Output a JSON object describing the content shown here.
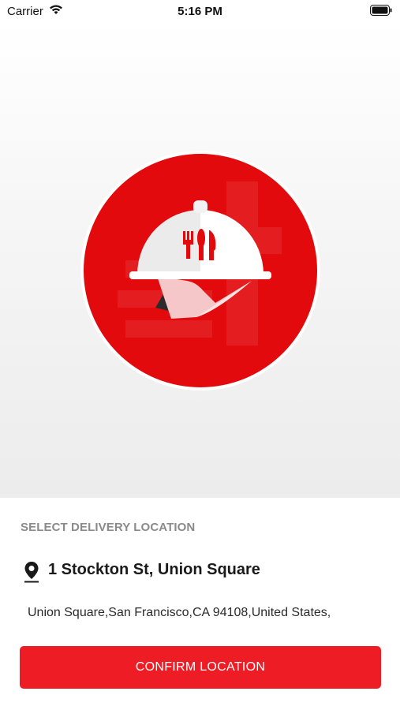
{
  "status_bar": {
    "carrier": "Carrier",
    "time": "5:16 PM",
    "wifi_icon": "wifi-icon",
    "battery_icon": "battery-icon"
  },
  "hero": {
    "logo_icon": "serving-cloche-logo",
    "colors": {
      "brand_red": "#e20a0d",
      "cloche": "#ffffff"
    }
  },
  "location": {
    "section_label": "SELECT DELIVERY LOCATION",
    "pin_icon": "location-pin-icon",
    "title": "1 Stockton St, Union Square",
    "full_address": "Union Square,San Francisco,CA 94108,United States,"
  },
  "confirm_button": {
    "label": "CONFIRM LOCATION",
    "color": "#ee1c25"
  }
}
